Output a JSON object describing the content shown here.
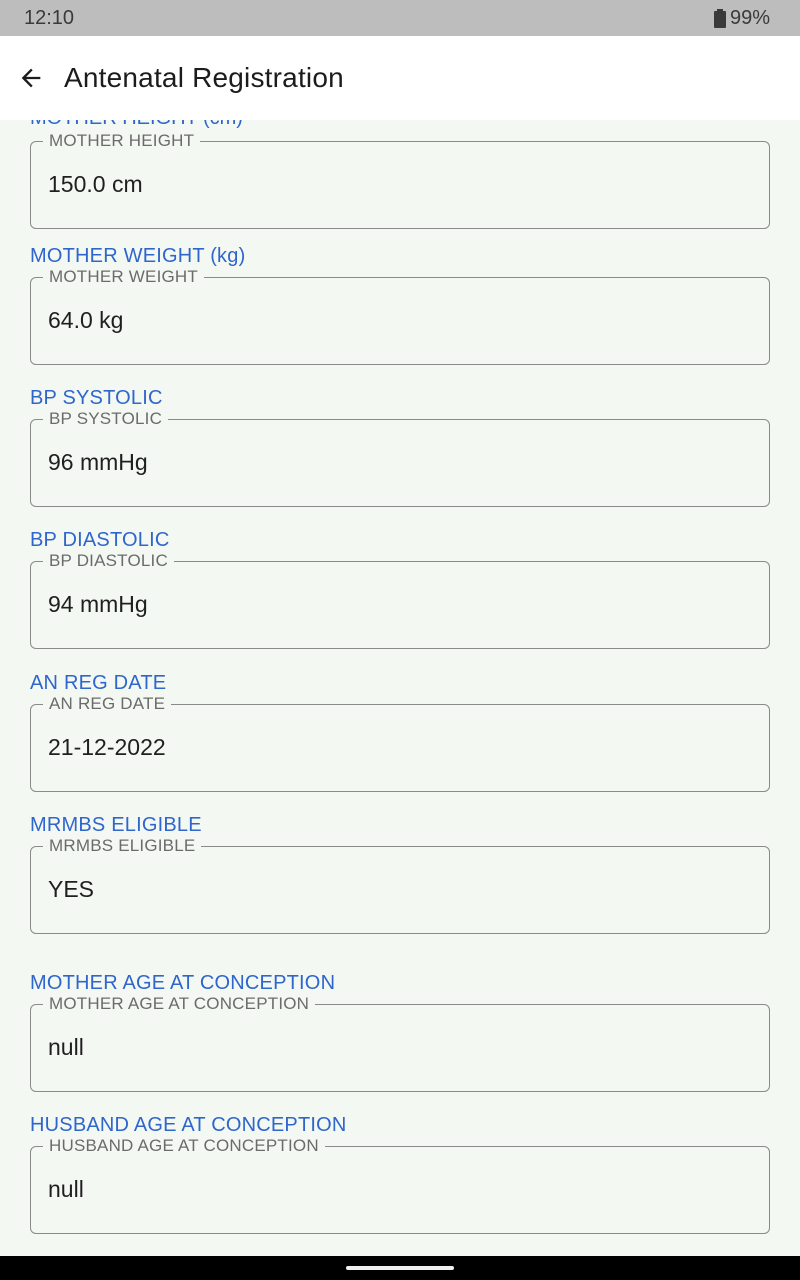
{
  "status": {
    "time": "12:10",
    "battery": "99%"
  },
  "app_bar": {
    "title": "Antenatal Registration",
    "back_icon": "arrow-left-icon"
  },
  "form": {
    "partial_heading": "MOTHER HEIGHT (cm)",
    "fields": [
      {
        "group_label": "MOTHER HEIGHT (cm)",
        "legend": "MOTHER HEIGHT",
        "value": "150.0 cm"
      },
      {
        "group_label": "MOTHER WEIGHT (kg)",
        "legend": "MOTHER WEIGHT",
        "value": "64.0 kg"
      },
      {
        "group_label": "BP SYSTOLIC",
        "legend": "BP SYSTOLIC",
        "value": "96 mmHg"
      },
      {
        "group_label": "BP DIASTOLIC",
        "legend": "BP DIASTOLIC",
        "value": "94 mmHg"
      },
      {
        "group_label": "AN REG DATE",
        "legend": "AN REG DATE",
        "value": "21-12-2022"
      },
      {
        "group_label": "MRMBS ELIGIBLE",
        "legend": "MRMBS ELIGIBLE",
        "value": "YES"
      },
      {
        "group_label": "MOTHER AGE AT CONCEPTION",
        "legend": "MOTHER AGE AT CONCEPTION",
        "value": "null"
      },
      {
        "group_label": "HUSBAND AGE AT CONCEPTION",
        "legend": "HUSBAND AGE AT CONCEPTION",
        "value": "null"
      }
    ]
  }
}
